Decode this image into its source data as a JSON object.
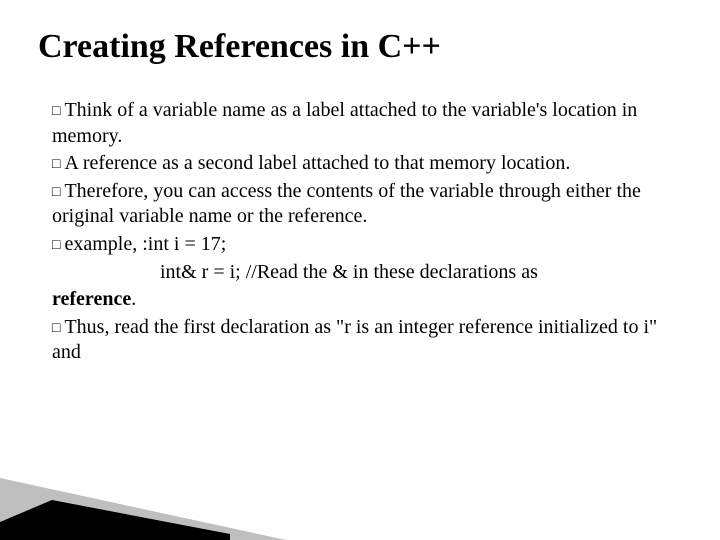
{
  "title": "Creating References in C++",
  "bullets": {
    "b1_lead": "Think",
    "b1_rest": " of a variable name as a label attached to the variable's location in memory.",
    "b2_lead": "A",
    "b2_rest": " reference as a second label attached to that memory location.",
    "b3_lead": "Therefore,",
    "b3_rest": " you can access the contents of the variable through either the original variable name or the reference.",
    "b4_lead": "example,",
    "b4_rest": " :int i = 17;",
    "b4_line2a": "int& r = i; //Read the & in these declarations as ",
    "b4_line2b": "reference",
    "b4_line2c": ".",
    "b5_lead": "Thus,",
    "b5_rest": " read the first declaration as \"r is an integer reference initialized to i\" and"
  },
  "square_glyph": "□"
}
